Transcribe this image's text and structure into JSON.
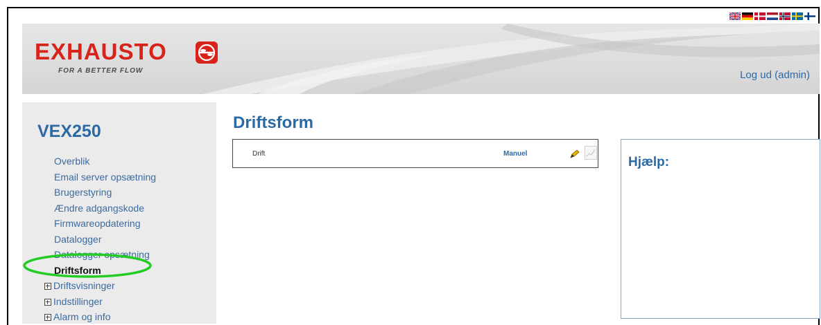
{
  "header": {
    "logo_text": "EXHAUSTO",
    "logo_tagline": "FOR A BETTER FLOW",
    "logout_label": "Log ud (admin)",
    "languages": [
      "english-flag",
      "german-flag",
      "danish-flag",
      "dutch-flag",
      "norwegian-flag",
      "swedish-flag",
      "finnish-flag"
    ]
  },
  "sidebar": {
    "device": "VEX250",
    "items": [
      {
        "label": "Overblik"
      },
      {
        "label": "Email server opsætning"
      },
      {
        "label": "Brugerstyring"
      },
      {
        "label": "Ændre adgangskode"
      },
      {
        "label": "Firmwareopdatering"
      },
      {
        "label": "Datalogger"
      },
      {
        "label": "Datalogger opsætning"
      },
      {
        "label": "Driftsform",
        "active": true
      },
      {
        "label": "Driftsvisninger",
        "expandable": true
      },
      {
        "label": "Indstillinger",
        "expandable": true
      },
      {
        "label": "Alarm og info",
        "expandable": true
      }
    ]
  },
  "main": {
    "title": "Driftsform",
    "row": {
      "label": "Drift",
      "value": "Manuel"
    }
  },
  "help": {
    "title": "Hjælp:"
  },
  "colors": {
    "brand_red": "#d8231b",
    "link_blue": "#2c6aa6",
    "highlight_green": "#22cc22"
  }
}
